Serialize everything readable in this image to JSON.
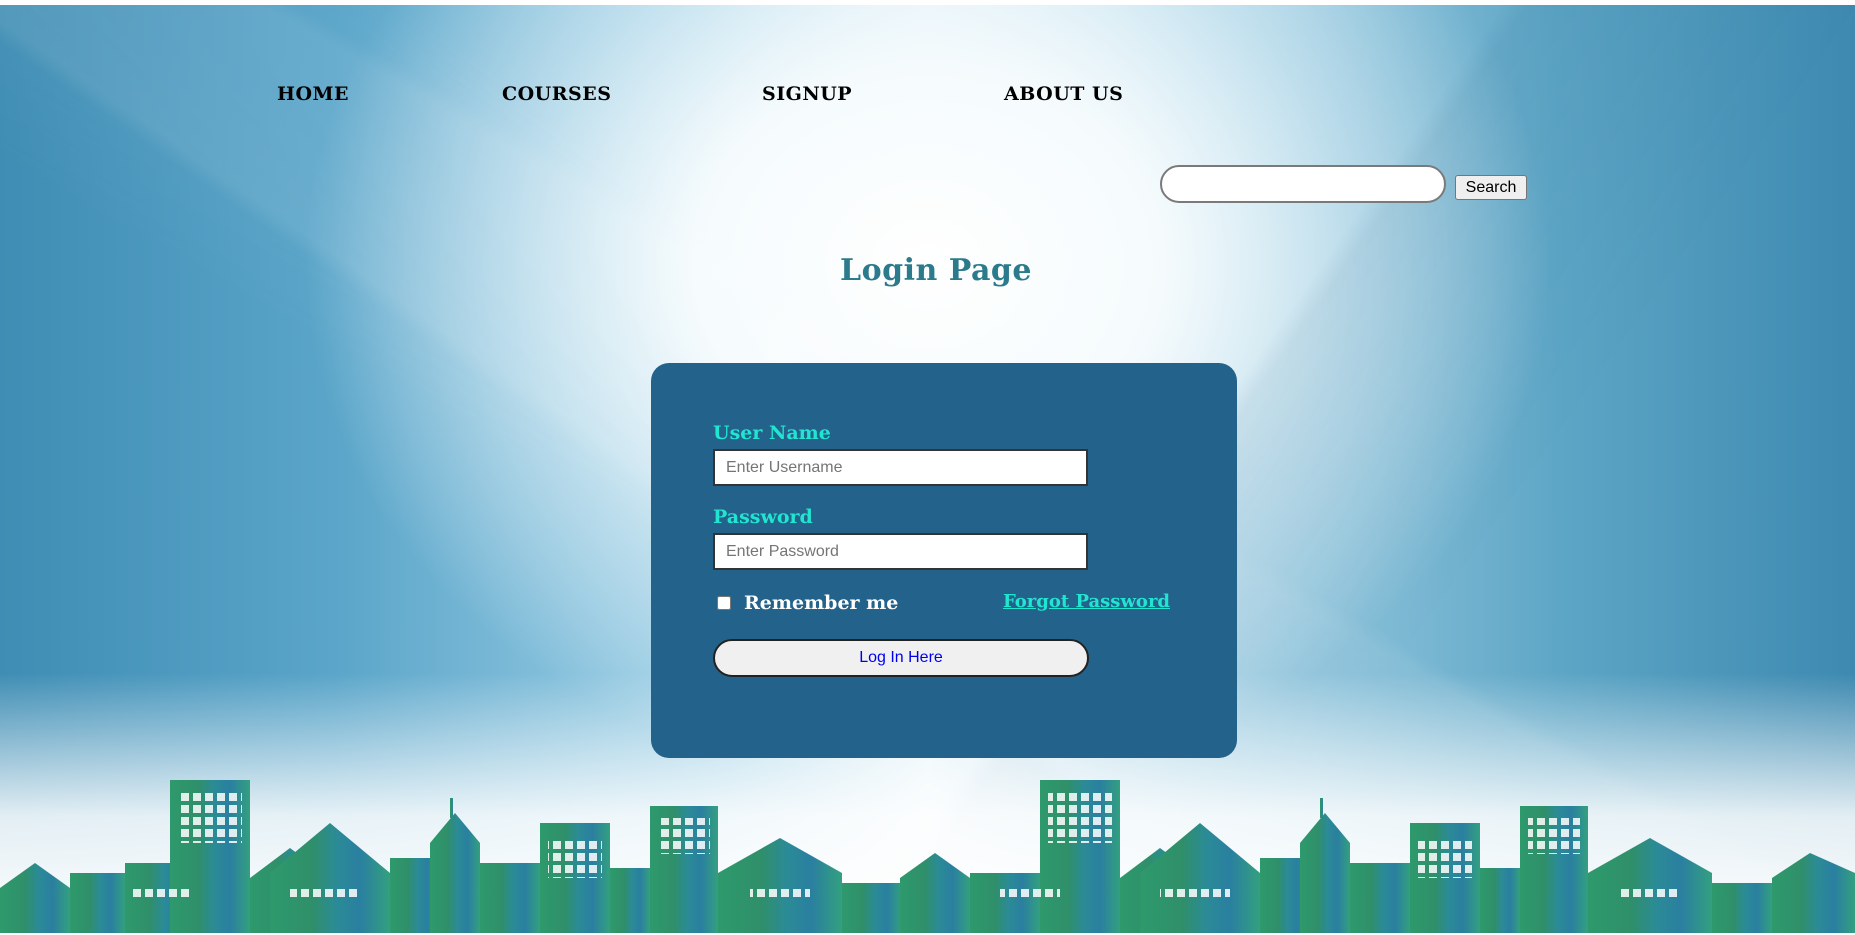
{
  "nav": {
    "items": [
      {
        "label": "HOME"
      },
      {
        "label": "COURSES"
      },
      {
        "label": "SIGNUP"
      },
      {
        "label": "ABOUT US"
      }
    ]
  },
  "search": {
    "value": "",
    "button_label": "Search"
  },
  "page_title": "Login Page",
  "login_form": {
    "username_label": "User Name",
    "username_placeholder": "Enter Username",
    "password_label": "Password",
    "password_placeholder": "Enter Password",
    "remember_label": "Remember me",
    "remember_checked": false,
    "forgot_label": "Forgot Password",
    "submit_label": "Log In Here"
  },
  "colors": {
    "form_background": "#23628b",
    "label_accent": "#21e5d0",
    "title": "#2b7b8c",
    "skyline_start": "#2e9a6c",
    "skyline_end": "#2a7fa0"
  },
  "decor": {
    "background": "faceted-blue-sky",
    "footer": "city-skyline-silhouette"
  }
}
